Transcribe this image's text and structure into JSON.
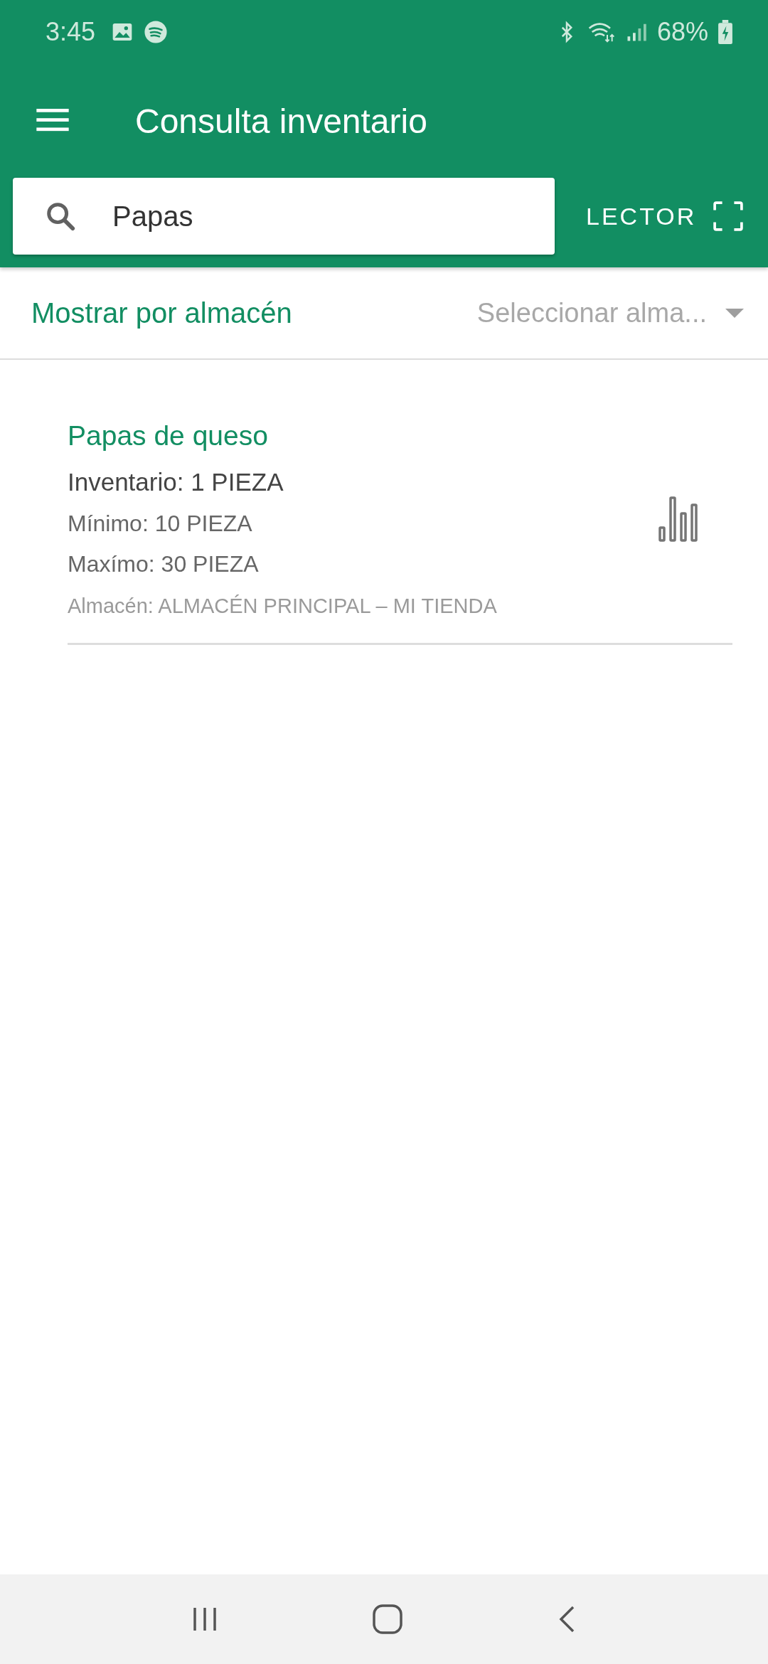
{
  "status_bar": {
    "time": "3:45",
    "battery": "68%"
  },
  "app_bar": {
    "title": "Consulta inventario"
  },
  "search": {
    "value": "Papas",
    "scanner_label": "LECTOR"
  },
  "filter": {
    "label": "Mostrar por almacén",
    "placeholder": "Seleccionar alma..."
  },
  "items": [
    {
      "name": "Papas de queso",
      "inventory": "Inventario: 1 PIEZA",
      "minimum": "Mínimo: 10 PIEZA",
      "maximum": "Maxímo: 30 PIEZA",
      "warehouse": "Almacén: ALMACÉN PRINCIPAL – MI TIENDA"
    }
  ]
}
